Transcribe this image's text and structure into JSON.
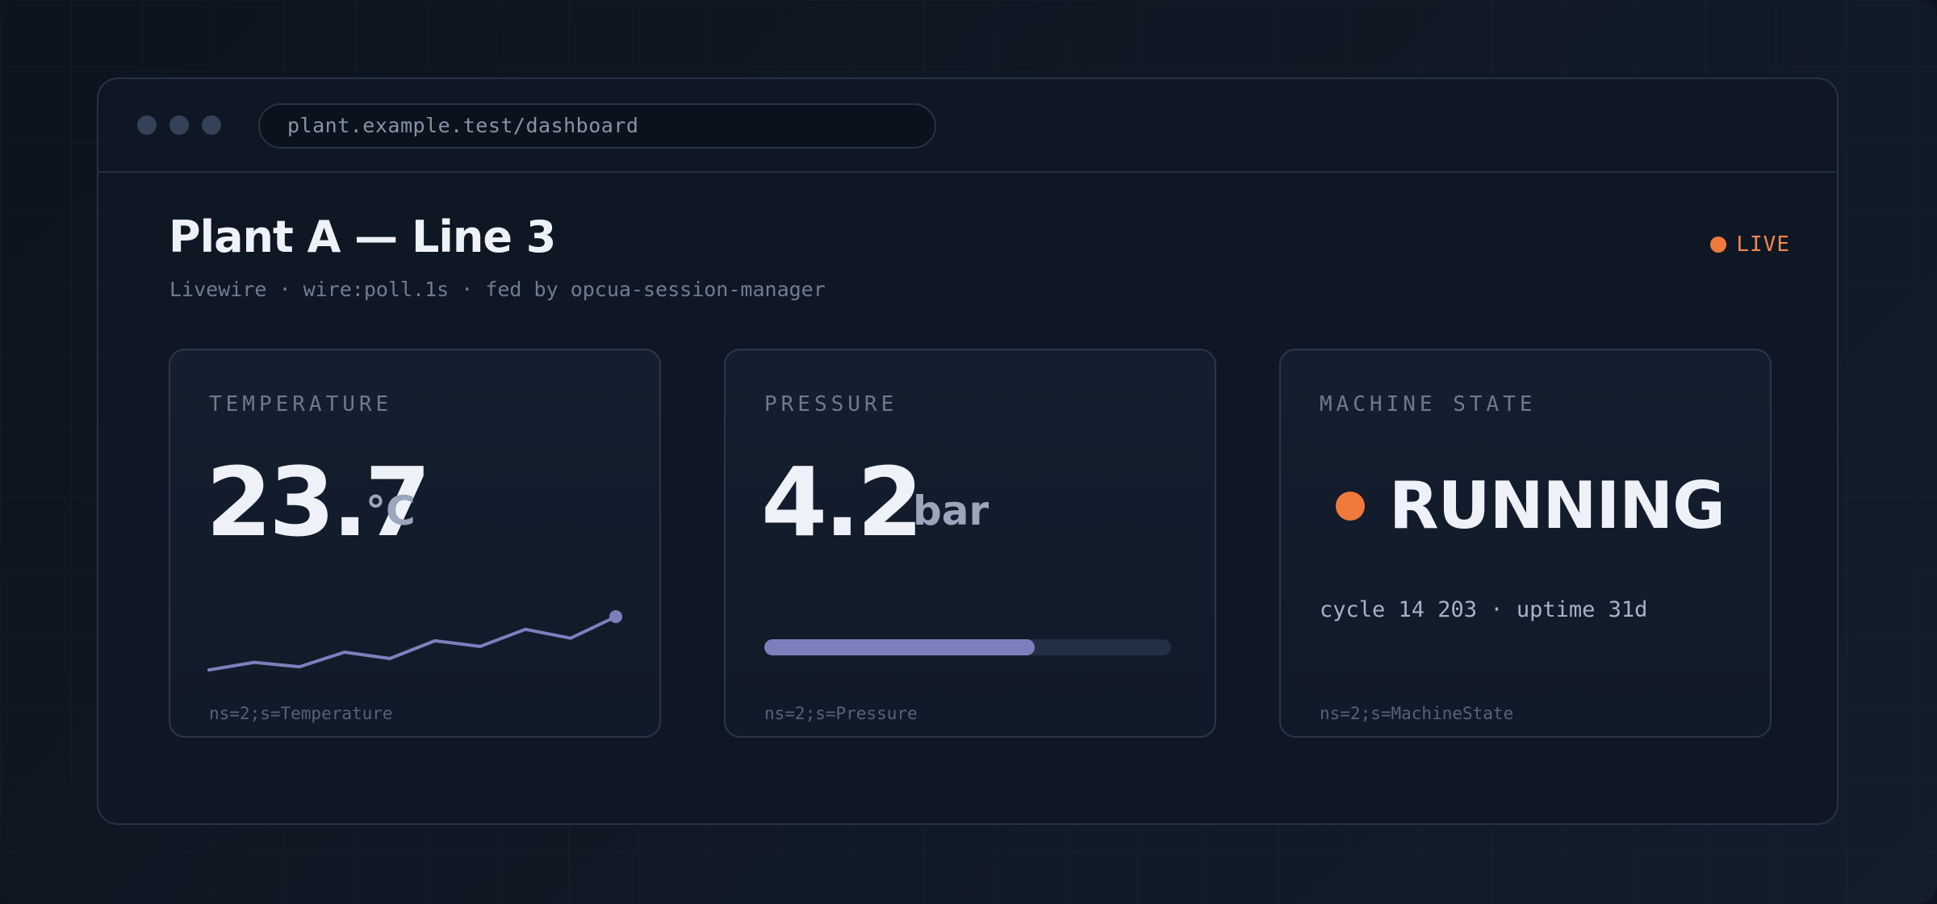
{
  "browser": {
    "url": "plant.example.test/dashboard"
  },
  "header": {
    "title": "Plant A — Line 3",
    "subtitle": "Livewire · wire:poll.1s · fed by opcua-session-manager",
    "live_label": "LIVE"
  },
  "cards": {
    "temperature": {
      "label": "TEMPERATURE",
      "value": "23.7",
      "unit": "°C",
      "node_id": "ns=2;s=Temperature",
      "trend": [
        2.0,
        3.2,
        2.5,
        4.8,
        3.8,
        6.6,
        5.7,
        8.4,
        7.0,
        10.4
      ],
      "trend_color": "#7d7fbd"
    },
    "pressure": {
      "label": "PRESSURE",
      "value": "4.2",
      "unit": "bar",
      "node_id": "ns=2;s=Pressure",
      "level_fraction": 0.665,
      "bar_color": "#7d7fbd"
    },
    "machine_state": {
      "label": "MACHINE STATE",
      "state": "RUNNING",
      "meta": "cycle 14 203 · uptime 31d",
      "node_id": "ns=2;s=MachineState",
      "state_color": "#f07a3c"
    }
  },
  "colors": {
    "accent": "#f07a3c",
    "series": "#7d7fbd"
  }
}
